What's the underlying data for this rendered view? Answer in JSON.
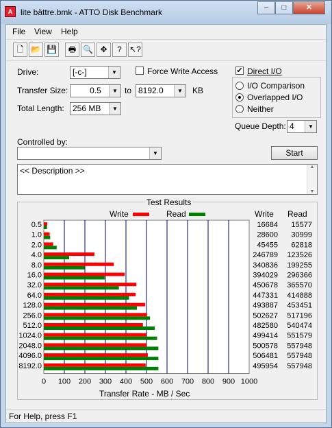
{
  "window": {
    "title": "lite bättre.bmk - ATTO Disk Benchmark",
    "app_icon": "atto-logo-icon",
    "minimize": "minimize-icon",
    "maximize": "maximize-icon",
    "close": "close-icon"
  },
  "menu": [
    "File",
    "View",
    "Help"
  ],
  "toolbar": [
    "new-icon",
    "open-icon",
    "save-icon",
    "print-icon",
    "print-preview-icon",
    "move-icon",
    "help-icon",
    "context-help-icon"
  ],
  "form": {
    "drive_label": "Drive:",
    "drive_value": "[-c-]",
    "force_write_label": "Force Write Access",
    "force_write_checked": false,
    "direct_io_label": "Direct I/O",
    "direct_io_checked": true,
    "transfer_size_label": "Transfer Size:",
    "transfer_from": "0.5",
    "to_label": "to",
    "transfer_to": "8192.0",
    "kb_label": "KB",
    "total_length_label": "Total Length:",
    "total_length_value": "256 MB",
    "io_comparison_label": "I/O Comparison",
    "overlapped_io_label": "Overlapped I/O",
    "neither_label": "Neither",
    "selected_mode": "Overlapped I/O",
    "queue_depth_label": "Queue Depth:",
    "queue_depth_value": "4",
    "controlled_by_label": "Controlled by:",
    "controlled_by_value": "",
    "start_label": "Start",
    "description": "<< Description >>"
  },
  "results": {
    "group_title": "Test Results",
    "write_legend": "Write",
    "read_legend": "Read",
    "write_header": "Write",
    "read_header": "Read",
    "write_color": "#ff0000",
    "read_color": "#008000"
  },
  "chart_data": {
    "type": "bar",
    "title": "Test Results",
    "xlabel": "Transfer Rate - MB / Sec",
    "ylabel": "",
    "xlim": [
      0,
      1000
    ],
    "x_ticks": [
      "0",
      "100",
      "200",
      "300",
      "400",
      "500",
      "600",
      "700",
      "800",
      "900",
      "1000"
    ],
    "categories": [
      "0.5",
      "1.0",
      "2.0",
      "4.0",
      "8.0",
      "16.0",
      "32.0",
      "64.0",
      "128.0",
      "256.0",
      "512.0",
      "1024.0",
      "2048.0",
      "4096.0",
      "8192.0"
    ],
    "series": [
      {
        "name": "Write",
        "color": "#ff0000",
        "values": [
          16684,
          28600,
          45455,
          246789,
          340836,
          394029,
          450678,
          447331,
          493887,
          502627,
          482580,
          499414,
          500578,
          506481,
          495954
        ]
      },
      {
        "name": "Read",
        "color": "#008000",
        "values": [
          15577,
          30999,
          62818,
          123526,
          199255,
          296366,
          365570,
          414888,
          453451,
          517196,
          540474,
          551579,
          557948,
          557948,
          557948
        ]
      }
    ],
    "grid": true,
    "legend": "top"
  },
  "status": "For Help, press F1"
}
